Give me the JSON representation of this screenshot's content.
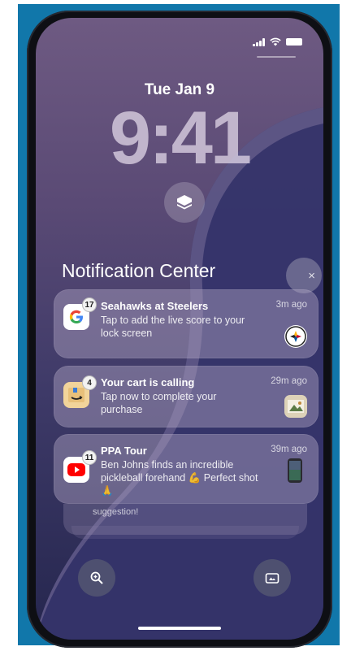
{
  "status_bar": {
    "icons": [
      "signal-icon",
      "wifi-icon",
      "battery-icon"
    ]
  },
  "lock_screen": {
    "date": "Tue Jan 9",
    "time": "9:41",
    "stack_icon": "stack-layers-icon"
  },
  "notification_center": {
    "title": "Notification Center",
    "clear_label": "×",
    "notifications": [
      {
        "app": "Google",
        "badge": "17",
        "title": "Seahawks at Steelers",
        "body": "Tap to add the live score to your lock screen",
        "time": "3m ago",
        "thumbnail": "steelers-logo"
      },
      {
        "app": "Amazon",
        "badge": "4",
        "title": "Your cart is calling",
        "body": "Tap now to complete your purchase",
        "time": "29m ago",
        "thumbnail": "product-image"
      },
      {
        "app": "YouTube",
        "badge": "11",
        "title": "PPA Tour",
        "body": "Ben Johns finds an incredible pickleball forehand 💪 Perfect shot 🙏",
        "time": "39m ago",
        "thumbnail": "video-thumbnail"
      }
    ],
    "stacked_peek_text": "suggestion!"
  },
  "bottom_controls": {
    "left": "magnifier-icon",
    "right": "camera-icon"
  },
  "colors": {
    "backdrop": "#1177aa",
    "google_blue": "#4285f4",
    "google_red": "#ea4335",
    "google_yellow": "#fbbc05",
    "google_green": "#34a853",
    "amazon_orange": "#ff9900",
    "youtube_red": "#ff0000"
  }
}
